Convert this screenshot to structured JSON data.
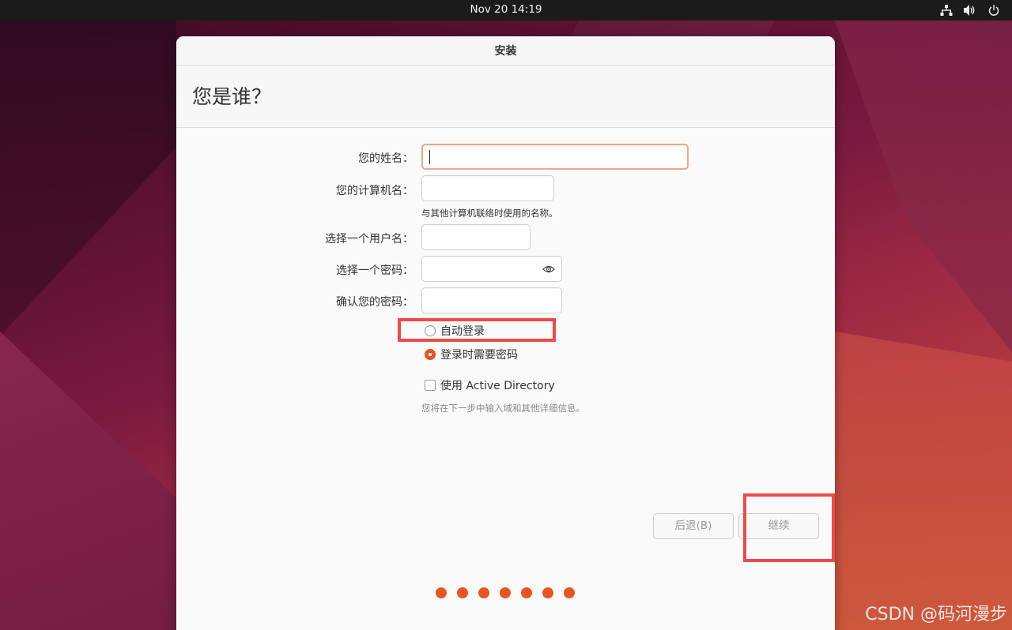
{
  "topbar": {
    "clock": "Nov 20  14:19",
    "tray_icons": [
      "network-icon",
      "volume-icon",
      "power-icon"
    ]
  },
  "window": {
    "title": "安装",
    "heading": "您是谁？"
  },
  "form": {
    "name_label": "您的姓名：",
    "name_value": "",
    "computer_label": "您的计算机名：",
    "computer_value": "",
    "computer_hint": "与其他计算机联络时使用的名称。",
    "username_label": "选择一个用户名：",
    "username_value": "",
    "password_label": "选择一个密码：",
    "password_value": "",
    "confirm_label": "确认您的密码：",
    "confirm_value": "",
    "login_options": [
      {
        "label": "自动登录",
        "selected": false
      },
      {
        "label": "登录时需要密码",
        "selected": true
      }
    ],
    "ad_label": "使用 Active Directory",
    "ad_checked": false,
    "ad_hint": "您将在下一步中输入域和其他详细信息。"
  },
  "buttons": {
    "back": "后退(B)",
    "continue": "继续"
  },
  "progress": {
    "total_steps": 7,
    "accent": "#e95420"
  },
  "watermark": "CSDN @码河漫步",
  "colors": {
    "accent": "#e95420",
    "highlight": "#ef4a4a",
    "topbar": "#1b1b1b"
  }
}
